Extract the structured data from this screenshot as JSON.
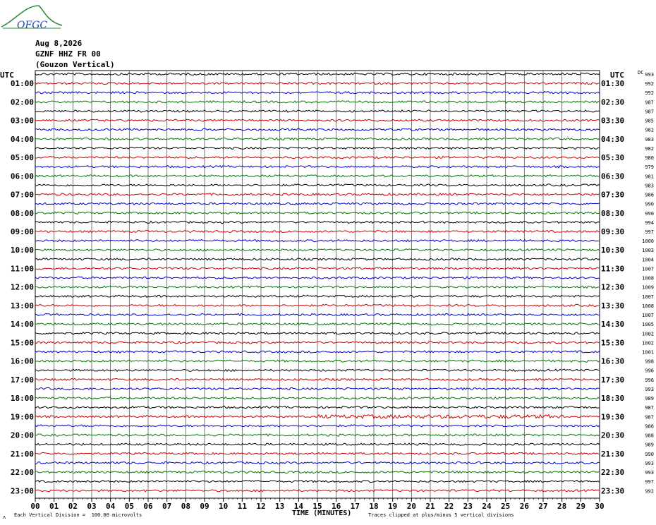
{
  "logo_text": "OFGC",
  "header": {
    "date": "Aug 8,2026",
    "station": "GZNF HHZ FR 00",
    "name": "(Gouzon Vertical)"
  },
  "footer": {
    "scale_note": "Each Vertical Division =  100.00 microvolts",
    "clip_note": "Traces clipped at plus/minus 5 vertical divisions",
    "corner_mark": "ʌ"
  },
  "chart_data": {
    "type": "line",
    "title": "",
    "xlabel": "TIME (MINUTES)",
    "ylabel_left": "UTC",
    "ylabel_right": "UTC",
    "dc_label": "DC",
    "xlim": [
      0,
      30
    ],
    "x_ticks": [
      "00",
      "01",
      "02",
      "03",
      "04",
      "05",
      "06",
      "07",
      "08",
      "09",
      "10",
      "11",
      "12",
      "13",
      "14",
      "15",
      "16",
      "17",
      "18",
      "19",
      "20",
      "21",
      "22",
      "23",
      "24",
      "25",
      "26",
      "27",
      "28",
      "29",
      "30"
    ],
    "left_time_labels": [
      "01:00",
      "02:00",
      "03:00",
      "04:00",
      "05:00",
      "06:00",
      "07:00",
      "08:00",
      "09:00",
      "10:00",
      "11:00",
      "12:00",
      "13:00",
      "14:00",
      "15:00",
      "16:00",
      "17:00",
      "18:00",
      "19:00",
      "20:00",
      "21:00",
      "22:00",
      "23:00"
    ],
    "right_time_labels": [
      "01:30",
      "02:30",
      "03:30",
      "04:30",
      "05:30",
      "06:30",
      "07:30",
      "08:30",
      "09:30",
      "10:30",
      "11:30",
      "12:30",
      "13:30",
      "14:30",
      "15:30",
      "16:30",
      "17:30",
      "18:30",
      "19:30",
      "20:30",
      "21:30",
      "22:30",
      "23:30"
    ],
    "trace_colors": [
      "#000000",
      "#cc0000",
      "#0000cc",
      "#007700"
    ],
    "grid": true,
    "dc_offsets": [
      "993",
      "992",
      "992",
      "987",
      "987",
      "985",
      "982",
      "983",
      "982",
      "980",
      "979",
      "981",
      "983",
      "986",
      "990",
      "990",
      "994",
      "997",
      "1000",
      "1003",
      "1004",
      "1007",
      "1008",
      "1009",
      "1007",
      "1008",
      "1007",
      "1005",
      "1002",
      "1002",
      "1001",
      "998",
      "996",
      "996",
      "993",
      "989",
      "987",
      "987",
      "986",
      "988",
      "989",
      "990",
      "993",
      "993",
      "997",
      "992"
    ]
  }
}
